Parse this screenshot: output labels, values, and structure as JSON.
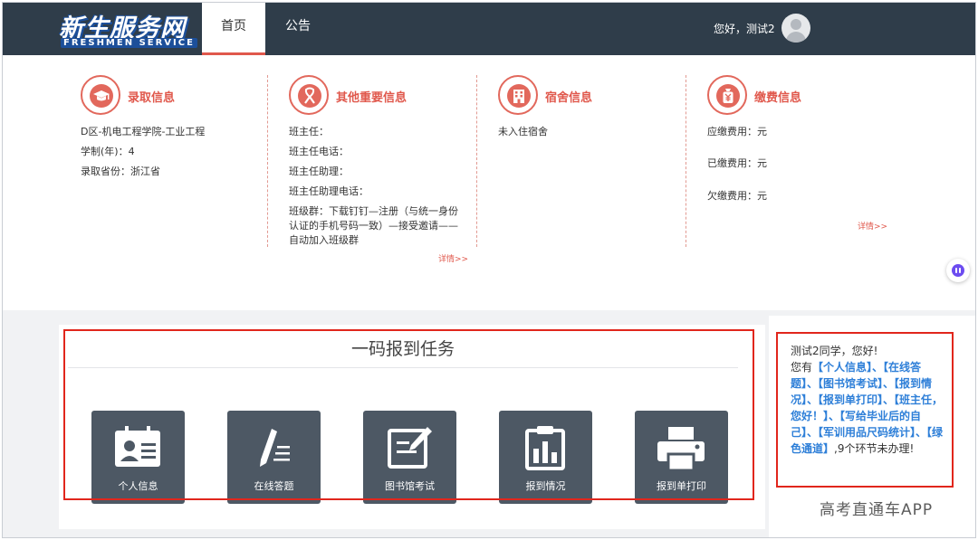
{
  "header": {
    "logo_main": "新生服务网",
    "logo_sub": "FRESHMEN SERVICE",
    "tabs": [
      {
        "label": "首页"
      },
      {
        "label": "公告"
      }
    ],
    "greeting": "您好，测试2"
  },
  "info_sections": {
    "admission": {
      "title": "录取信息",
      "lines": [
        "D区-机电工程学院-工业工程",
        "学制(年)：4",
        "录取省份：浙江省"
      ]
    },
    "other": {
      "title": "其他重要信息",
      "lines": [
        "班主任：",
        "班主任电话：",
        "班主任助理：",
        "班主任助理电话：",
        "班级群：下载钉钉—注册（与统一身份",
        "认证的手机号码一致）—接受邀请——",
        "自动加入班级群"
      ],
      "more": "详情>>"
    },
    "dorm": {
      "title": "宿舍信息",
      "lines": [
        "未入住宿舍"
      ]
    },
    "fees": {
      "title": "缴费信息",
      "lines": [
        "应缴费用：元",
        "已缴费用：元",
        "欠缴费用：元"
      ],
      "more": "详情>>"
    }
  },
  "tasks": {
    "title": "一码报到任务",
    "items": [
      {
        "label": "个人信息",
        "icon": "id-card-icon"
      },
      {
        "label": "在线答题",
        "icon": "pen-list-icon"
      },
      {
        "label": "图书馆考试",
        "icon": "edit-note-icon"
      },
      {
        "label": "报到情况",
        "icon": "bar-chart-clipboard-icon"
      },
      {
        "label": "报到单打印",
        "icon": "printer-icon"
      }
    ]
  },
  "side_notice": {
    "greeting": "测试2同学，您好!",
    "prefix": "您有",
    "links": "【个人信息】、【在线答题】、【图书馆考试】、【报到情况】、【报到单打印】、【班主任，您好！】、【写给毕业后的自己】、【军训用品尺码统计】、【绿色通道】",
    "suffix": ",9个环节未办理!"
  },
  "watermark": "高考直通车APP",
  "colors": {
    "nav_bg": "#2f3d4a",
    "accent_red": "#e0584c",
    "tile_bg": "#4d5864",
    "link_blue": "#2e7fd8",
    "highlight_box": "#e1261c"
  }
}
